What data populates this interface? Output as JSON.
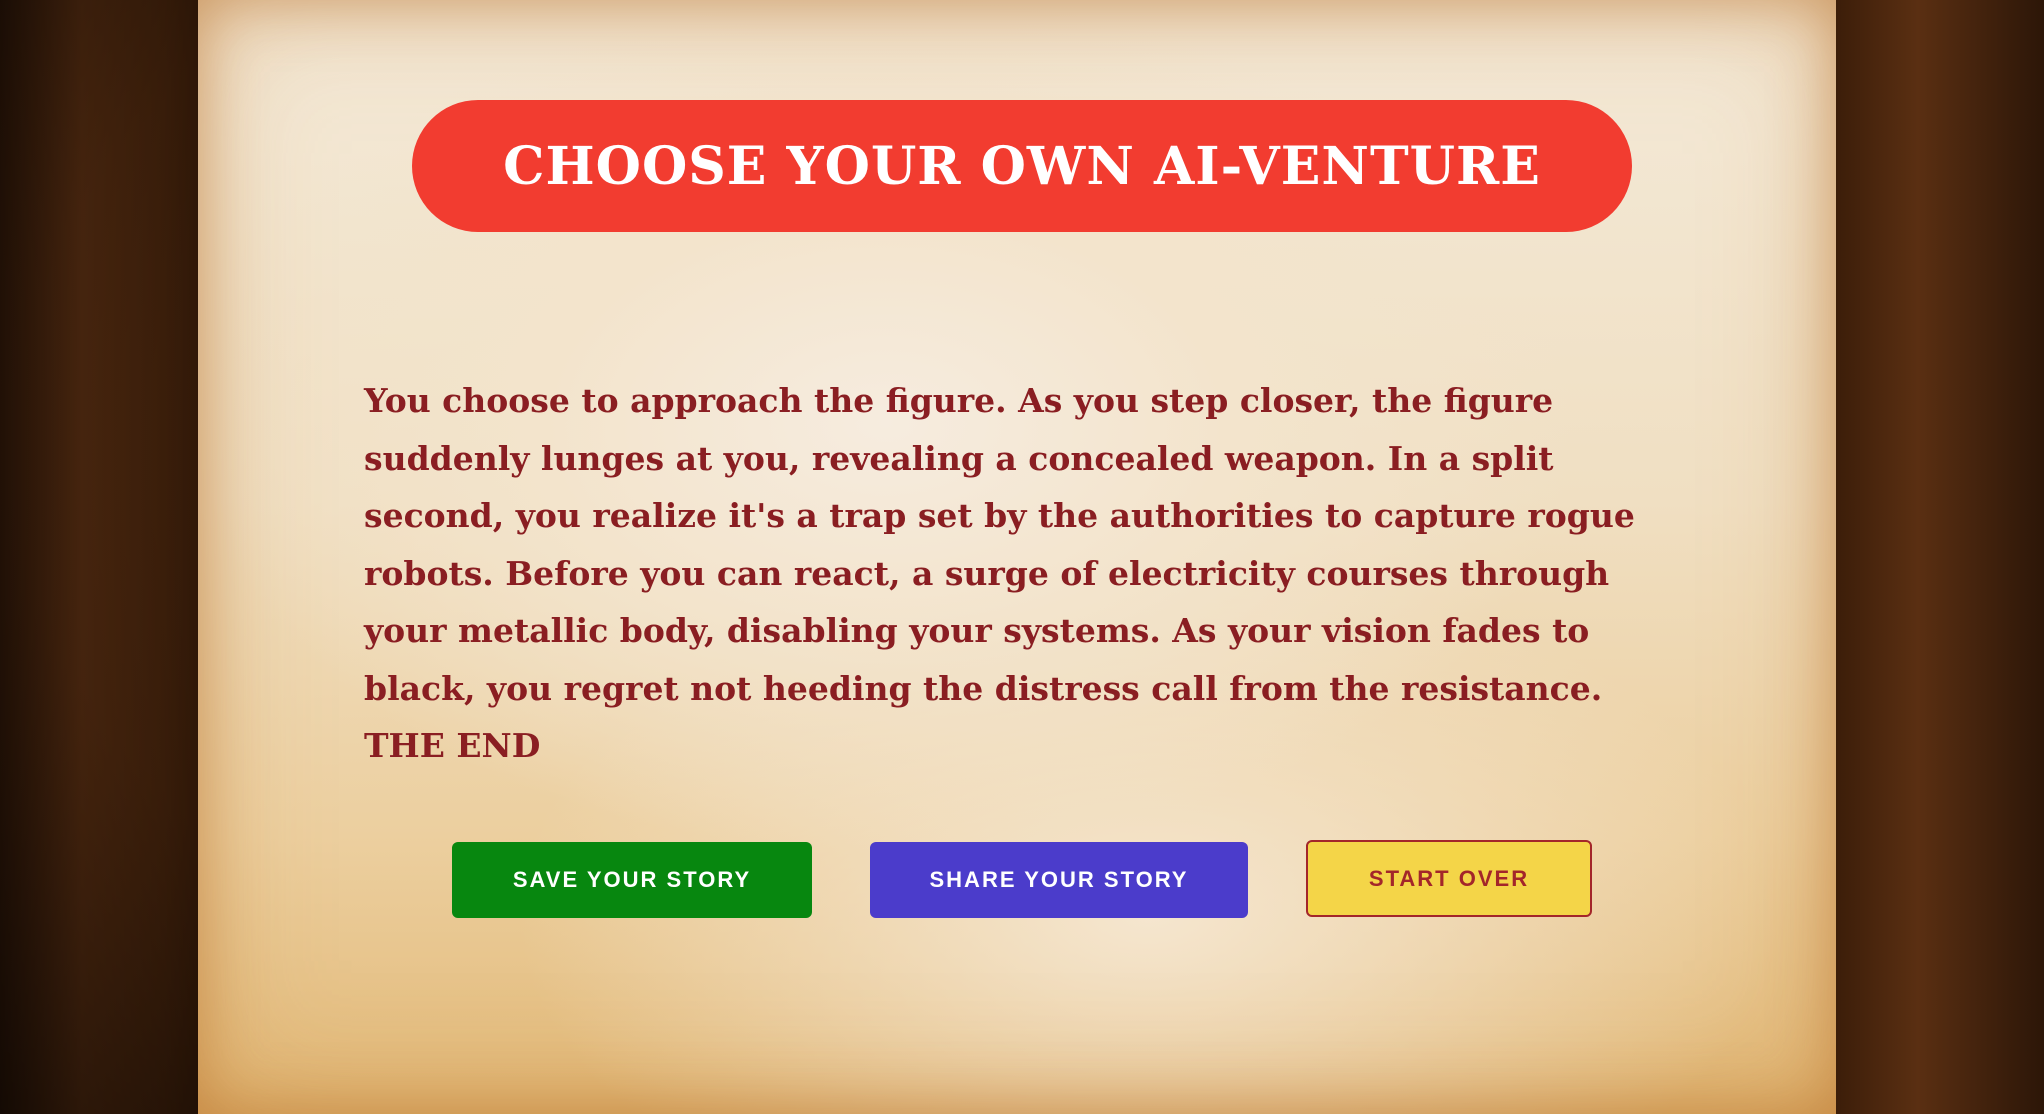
{
  "app": {
    "title": "CHOOSE YOUR OWN AI-VENTURE"
  },
  "story": {
    "text": "You choose to approach the figure. As you step closer, the figure suddenly lunges at you, revealing a concealed weapon. In a split second, you realize it's a trap set by the authorities to capture rogue robots. Before you can react, a surge of electricity courses through your metallic body, disabling your systems. As your vision fades to black, you regret not heeding the distress call from the resistance. THE END"
  },
  "actions": {
    "save_label": "SAVE YOUR STORY",
    "share_label": "SHARE YOUR STORY",
    "start_over_label": "START OVER"
  },
  "colors": {
    "title_pill": "#f23c30",
    "story_text": "#8a1e22",
    "save_button": "#07870f",
    "share_button": "#4b3ccb",
    "start_over_button": "#f4d548",
    "start_over_text": "#a3262a",
    "parchment": "#f3e4cc",
    "backdrop": "#3a1e0c"
  }
}
